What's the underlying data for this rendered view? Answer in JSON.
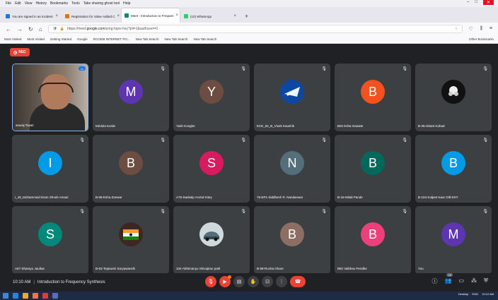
{
  "browser": {
    "menu": [
      "File",
      "Edit",
      "View",
      "History",
      "Bookmarks",
      "Tools",
      "Take sharing ghost tool",
      "Help"
    ],
    "tabs": [
      {
        "title": "You are signed in as Incident",
        "active": false,
        "color": "#1a73e8"
      },
      {
        "title": "Registration for Value Added C",
        "active": false,
        "color": "#e37400"
      },
      {
        "title": "Meet - Introduction to Frequen",
        "subtitle": "Activity",
        "active": true,
        "color": "#00897b"
      },
      {
        "title": "(10) WhatsApp",
        "active": false,
        "color": "#25d366"
      }
    ],
    "url_prefix": "https://meet.",
    "url_domain": "google.com",
    "url_rest": "/ymg-hqxv-hsy?pli=1&authuser=0",
    "bookmarks": [
      "Most Visited",
      "Most Visited",
      "Getting Started",
      "Google",
      "RCOEM INTERNET PO...",
      "New Tab Search",
      "New Tab Search",
      "New Tab Search"
    ],
    "other_bookmarks": "Other Bookmarks"
  },
  "meet": {
    "rec_label": "REC",
    "participants": [
      {
        "name": "anuraj Tiwari",
        "initial": "",
        "color": "#5a5048",
        "self_video": true
      },
      {
        "name": "Mridula Korde",
        "initial": "M",
        "color": "#5e35b1"
      },
      {
        "name": "Yash Konghe",
        "initial": "Y",
        "color": "#6d4c41"
      },
      {
        "name": "ECE_82_B_Vivek Kaushik",
        "initial": "",
        "color": "#0d47a1",
        "photo": "logo-blue"
      },
      {
        "name": "B02 Esha Gawate",
        "initial": "B",
        "color": "#f4511e"
      },
      {
        "name": "B-35-Ishant Kohad",
        "initial": "",
        "color": "#111111",
        "photo": "dark"
      },
      {
        "name": "I_49_Mohammad Ikram Shoeb Ansari",
        "initial": "I",
        "color": "#039be5"
      },
      {
        "name": "B-08-Esha Zanwar",
        "initial": "B",
        "color": "#6d4c41"
      },
      {
        "name": "A75-Sankalp Arvind Kitey",
        "initial": "S",
        "color": "#d81b60"
      },
      {
        "name": "76-EP1-Siddhesh R. Nandanwar",
        "initial": "N",
        "color": "#546e7a"
      },
      {
        "name": "B-15-Mitali Pande",
        "initial": "B",
        "color": "#00695c"
      },
      {
        "name": "B-104-Kuljeet Kaur GIll-DSY",
        "initial": "B",
        "color": "#039be5"
      },
      {
        "name": "A57-Sharayu Jaulkar",
        "initial": "S",
        "color": "#00897b"
      },
      {
        "name": "B-63-Tejaswini Suryawanshi",
        "initial": "",
        "color": "#3e2723",
        "photo": "flag"
      },
      {
        "name": "104-Abhimanyu Shivajirao patil",
        "initial": "",
        "color": "#cfd8dc",
        "photo": "car"
      },
      {
        "name": "B-58-Rucha Ghare",
        "initial": "B",
        "color": "#8d6e63"
      },
      {
        "name": "B82 Vaibhav Pendke",
        "initial": "B",
        "color": "#ec407a"
      },
      {
        "name": "You",
        "initial": "M",
        "color": "#5e35b1"
      }
    ],
    "time": "10:10 AM",
    "meeting_title": "Introduction to Frequency Synthesis",
    "participant_count": "18"
  },
  "taskbar": {
    "tray_text": "Desktop",
    "lang": "ENG",
    "clock": "10:10 AM"
  }
}
